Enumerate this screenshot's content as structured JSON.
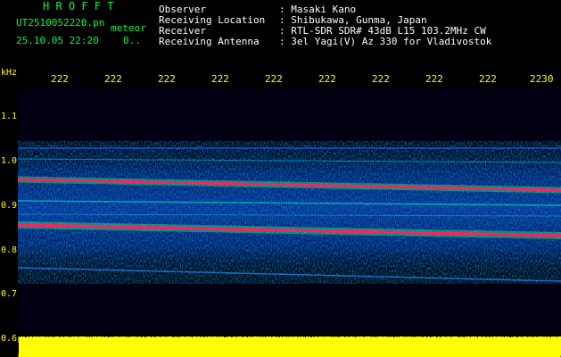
{
  "app": {
    "brand": "H R O F F T",
    "filename": "UT2510052220.pn",
    "type_label": "meteor",
    "datetime": "25.10.05 22:20",
    "count": "0.."
  },
  "observer": {
    "labels": [
      "Observer",
      "Receiving Location",
      "Receiver",
      "Receiving Antenna"
    ],
    "values": [
      ": Masaki Kano",
      ": Shibukawa, Gunma, Japan",
      ": RTL-SDR SDR# 43dB L15 103.2MHz CW",
      ": 3el Yagi(V) Az 330 for Vladivostok"
    ]
  },
  "axis": {
    "unit": "kHz",
    "y_ticks": [
      "1.1",
      "1.0",
      "0.9",
      "0.8",
      "0.7",
      "0.6"
    ],
    "x_ticks": [
      "222",
      "222",
      "222",
      "222",
      "222",
      "222",
      "222",
      "222",
      "222",
      "2230"
    ]
  },
  "colors": {
    "label": "#00ff40",
    "tick": "#ffff00",
    "header_text": "#ffffff",
    "trace_hot": "#ff2060",
    "trace_green": "#00ff80",
    "noise_blue": "#0030c0",
    "histogram": "#ffff00"
  }
}
